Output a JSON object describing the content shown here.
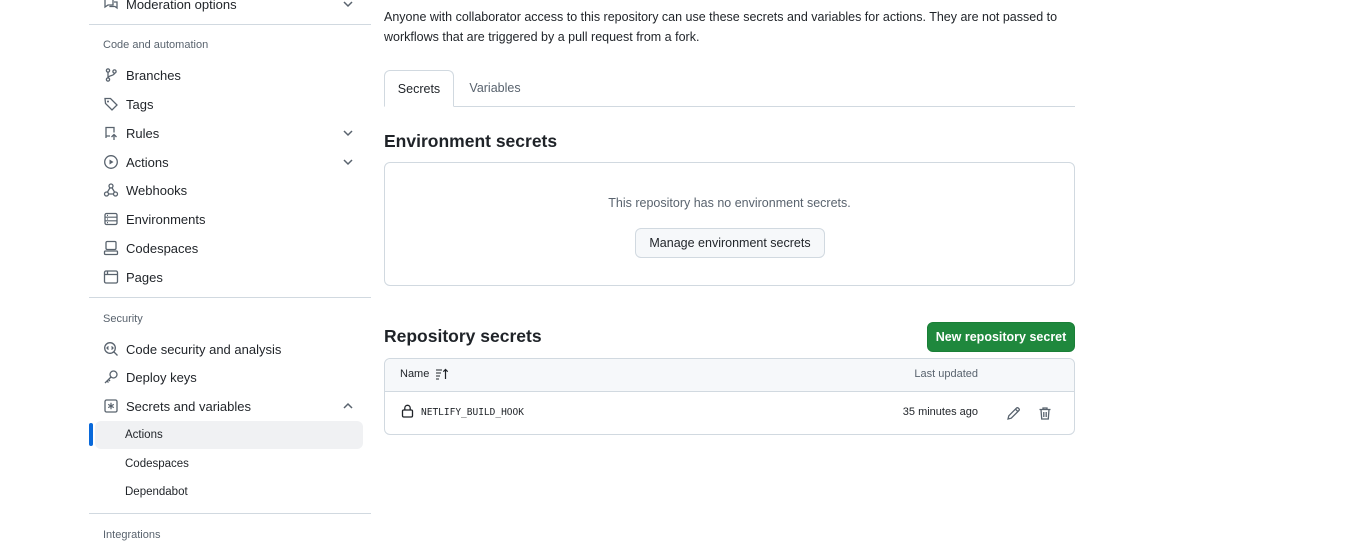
{
  "sidebar": {
    "top_item": {
      "label": "Moderation options",
      "icon": "comment-discussion-icon"
    },
    "sections": {
      "code_automation": "Code and automation",
      "security": "Security",
      "integrations": "Integrations"
    },
    "items": {
      "branches": "Branches",
      "tags": "Tags",
      "rules": "Rules",
      "actions": "Actions",
      "webhooks": "Webhooks",
      "environments": "Environments",
      "codespaces": "Codespaces",
      "pages": "Pages",
      "code_security": "Code security and analysis",
      "deploy_keys": "Deploy keys",
      "secrets_vars": "Secrets and variables"
    },
    "sub_items": {
      "actions": "Actions",
      "codespaces": "Codespaces",
      "dependabot": "Dependabot"
    },
    "active_color": "#0969da"
  },
  "main": {
    "intro": "Anyone with collaborator access to this repository can use these secrets and variables for actions. They are not passed to workflows that are triggered by a pull request from a fork.",
    "tabs": {
      "secrets": "Secrets",
      "variables": "Variables"
    },
    "env_secrets": {
      "title": "Environment secrets",
      "empty_text": "This repository has no environment secrets.",
      "manage_button": "Manage environment secrets"
    },
    "repo_secrets": {
      "title": "Repository secrets",
      "new_button": "New repository secret",
      "col_name": "Name",
      "col_updated": "Last updated",
      "rows": [
        {
          "name": "NETLIFY_BUILD_HOOK",
          "updated": "35 minutes ago"
        }
      ]
    },
    "colors": {
      "primary_button": "#1f883d",
      "border": "#d1d9e0"
    }
  }
}
